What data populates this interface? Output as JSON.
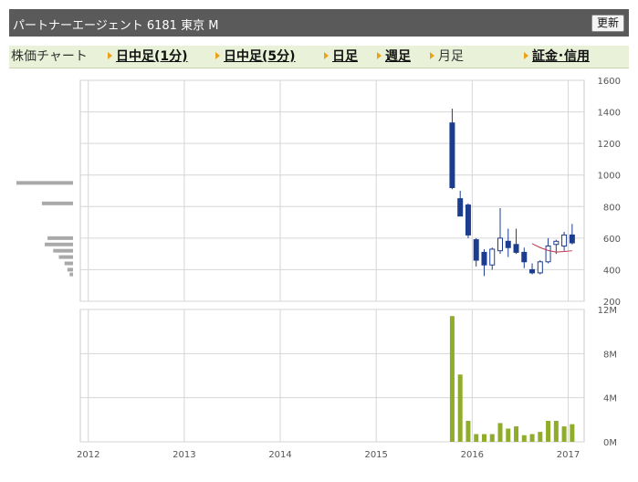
{
  "header": {
    "title": "パートナーエージェント 6181 東京 M",
    "refresh_label": "更新"
  },
  "tabs": [
    {
      "label": "株価チャート",
      "kind": "label"
    },
    {
      "label": "日中足(1分)",
      "kind": "link"
    },
    {
      "label": "日中足(5分)",
      "kind": "link"
    },
    {
      "label": "日足",
      "kind": "link"
    },
    {
      "label": "週足",
      "kind": "link"
    },
    {
      "label": "月足",
      "kind": "current"
    },
    {
      "label": "証金･信用",
      "kind": "link"
    }
  ],
  "colors": {
    "candle_down": "#1c3d8f",
    "candle_up": "#ffffff",
    "candle_outline": "#1c3d8f",
    "volume_bar": "#8fac2a",
    "moving_average": "#c0354a",
    "volume_profile": "#a9a9a9",
    "grid": "#d6d6d6",
    "header_bg": "#5a5a5a",
    "tab_bg": "#e9f2d8",
    "tab_arrow": "#e9a21a"
  },
  "chart_data": {
    "type": "candlestick",
    "x_ticks": [
      "2012",
      "2013",
      "2014",
      "2015",
      "2016",
      "2017"
    ],
    "x_range": [
      "2011-12",
      "2017-02"
    ],
    "price_axis": {
      "ticks": [
        "1600",
        "1400",
        "1200",
        "1000",
        "800",
        "600",
        "400",
        "200"
      ],
      "ylim": [
        200,
        1600
      ]
    },
    "volume_axis": {
      "ticks": [
        "12M",
        "8M",
        "4M",
        "0M"
      ],
      "ylim": [
        0,
        12
      ]
    },
    "candles": [
      {
        "date": "2015-10",
        "open": 1330,
        "high": 1420,
        "low": 910,
        "close": 920
      },
      {
        "date": "2015-11",
        "open": 850,
        "high": 900,
        "low": 760,
        "close": 740
      },
      {
        "date": "2015-12",
        "open": 810,
        "high": 820,
        "low": 600,
        "close": 620
      },
      {
        "date": "2016-01",
        "open": 590,
        "high": 600,
        "low": 420,
        "close": 460
      },
      {
        "date": "2016-02",
        "open": 510,
        "high": 530,
        "low": 360,
        "close": 430
      },
      {
        "date": "2016-03",
        "open": 430,
        "high": 540,
        "low": 400,
        "close": 530
      },
      {
        "date": "2016-04",
        "open": 520,
        "high": 790,
        "low": 500,
        "close": 600
      },
      {
        "date": "2016-05",
        "open": 580,
        "high": 660,
        "low": 480,
        "close": 540
      },
      {
        "date": "2016-06",
        "open": 560,
        "high": 660,
        "low": 500,
        "close": 510
      },
      {
        "date": "2016-07",
        "open": 510,
        "high": 540,
        "low": 410,
        "close": 450
      },
      {
        "date": "2016-08",
        "open": 400,
        "high": 440,
        "low": 370,
        "close": 380
      },
      {
        "date": "2016-09",
        "open": 380,
        "high": 460,
        "low": 370,
        "close": 450
      },
      {
        "date": "2016-10",
        "open": 450,
        "high": 600,
        "low": 440,
        "close": 550
      },
      {
        "date": "2016-11",
        "open": 560,
        "high": 590,
        "low": 500,
        "close": 580
      },
      {
        "date": "2016-12",
        "open": 550,
        "high": 640,
        "low": 520,
        "close": 620
      },
      {
        "date": "2017-01",
        "open": 620,
        "high": 690,
        "low": 560,
        "close": 570
      }
    ],
    "volume_millions": [
      11.4,
      6.1,
      1.9,
      0.7,
      0.7,
      0.7,
      1.7,
      1.2,
      1.4,
      0.6,
      0.7,
      0.9,
      1.9,
      1.9,
      1.4,
      1.6
    ],
    "moving_average": [
      {
        "date": "2016-08",
        "value": 565
      },
      {
        "date": "2016-09",
        "value": 540
      },
      {
        "date": "2016-10",
        "value": 522
      },
      {
        "date": "2016-11",
        "value": 512
      },
      {
        "date": "2016-12",
        "value": 515
      },
      {
        "date": "2017-01",
        "value": 520
      }
    ],
    "price_volume_profile": [
      {
        "price": 950,
        "weight": 1.0
      },
      {
        "price": 820,
        "weight": 0.55
      },
      {
        "price": 600,
        "weight": 0.45
      },
      {
        "price": 560,
        "weight": 0.5
      },
      {
        "price": 520,
        "weight": 0.35
      },
      {
        "price": 480,
        "weight": 0.25
      },
      {
        "price": 440,
        "weight": 0.15
      },
      {
        "price": 400,
        "weight": 0.1
      },
      {
        "price": 370,
        "weight": 0.06
      }
    ]
  }
}
